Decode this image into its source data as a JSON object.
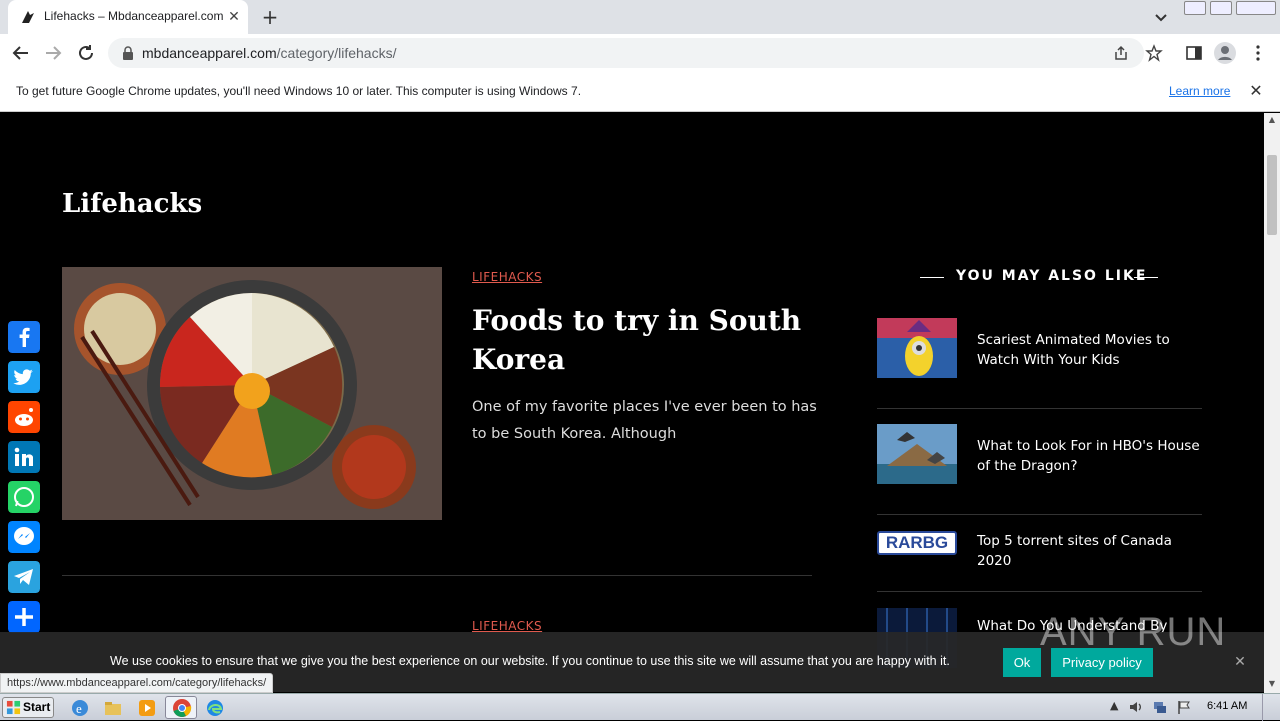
{
  "browser": {
    "tab_title": "Lifehacks – Mbdanceapparel.com",
    "url_host": "mbdanceapparel.com",
    "url_path": "/category/lifehacks/",
    "status_url": "https://www.mbdanceapparel.com/category/lifehacks/"
  },
  "infobar": {
    "message": "To get future Google Chrome updates, you'll need Windows 10 or later. This computer is using Windows 7.",
    "link": "Learn more"
  },
  "page": {
    "title": "Lifehacks",
    "articles": [
      {
        "category": "LIFEHACKS",
        "title": "Foods to try in South Korea",
        "excerpt": "One of my favorite places I've ever been to has to be South Korea. Although"
      },
      {
        "category": "LIFEHACKS"
      }
    ],
    "sidebar": {
      "heading": "YOU MAY ALSO LIKE",
      "items": [
        {
          "title": "Scariest Animated Movies to Watch With Your Kids"
        },
        {
          "title": "What to Look For in HBO's House of the Dragon?"
        },
        {
          "title": "Top 5 torrent sites of Canada 2020",
          "thumb_text": "RARBG"
        },
        {
          "title": "What Do You Understand By"
        }
      ]
    }
  },
  "cookie": {
    "message": "We use cookies to ensure that we give you the best experience on our website. If you continue to use this site we will assume that you are happy with it.",
    "ok": "Ok",
    "policy": "Privacy policy"
  },
  "watermark": "ANY RUN",
  "taskbar": {
    "start": "Start",
    "clock": "6:41 AM"
  },
  "colors": {
    "accent": "#e05a4e",
    "cookie_button": "#00a99d",
    "facebook": "#1877f2",
    "twitter": "#1da1f2",
    "reddit": "#ff4500",
    "linkedin": "#0077b5",
    "whatsapp": "#25d366",
    "messenger": "#0084ff",
    "telegram": "#2aa3df",
    "share": "#0166ff"
  }
}
